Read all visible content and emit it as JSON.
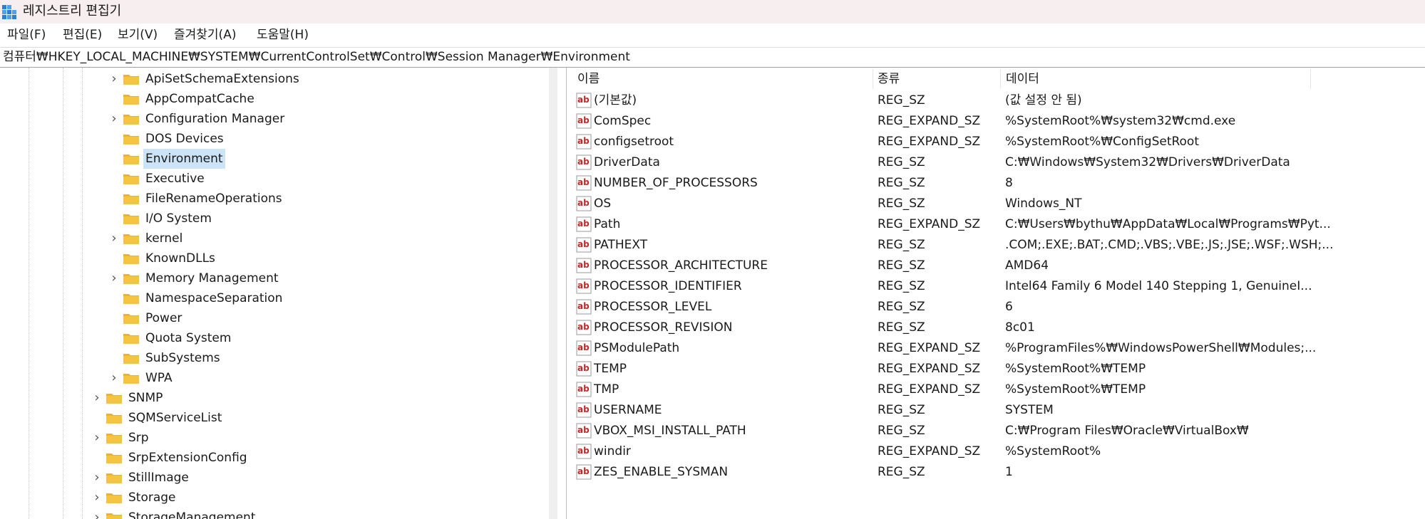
{
  "window": {
    "title": "레지스트리 편집기"
  },
  "menu": [
    "파일(F)",
    "편집(E)",
    "보기(V)",
    "즐겨찾기(A)",
    "도움말(H)"
  ],
  "address": "컴퓨터₩HKEY_LOCAL_MACHINE₩SYSTEM₩CurrentControlSet₩Control₩Session Manager₩Environment",
  "tree": {
    "nodes": [
      {
        "label": "ApiSetSchemaExtensions",
        "expandable": true
      },
      {
        "label": "AppCompatCache",
        "expandable": false
      },
      {
        "label": "Configuration Manager",
        "expandable": true
      },
      {
        "label": "DOS Devices",
        "expandable": false
      },
      {
        "label": "Environment",
        "expandable": false,
        "selected": true
      },
      {
        "label": "Executive",
        "expandable": false
      },
      {
        "label": "FileRenameOperations",
        "expandable": false
      },
      {
        "label": "I/O System",
        "expandable": false
      },
      {
        "label": "kernel",
        "expandable": true
      },
      {
        "label": "KnownDLLs",
        "expandable": false
      },
      {
        "label": "Memory Management",
        "expandable": true
      },
      {
        "label": "NamespaceSeparation",
        "expandable": false
      },
      {
        "label": "Power",
        "expandable": false
      },
      {
        "label": "Quota System",
        "expandable": false
      },
      {
        "label": "SubSystems",
        "expandable": false
      },
      {
        "label": "WPA",
        "expandable": true
      },
      {
        "label": "SNMP",
        "expandable": true
      },
      {
        "label": "SQMServiceList",
        "expandable": false
      },
      {
        "label": "Srp",
        "expandable": true
      },
      {
        "label": "SrpExtensionConfig",
        "expandable": false
      },
      {
        "label": "StillImage",
        "expandable": true
      },
      {
        "label": "Storage",
        "expandable": true
      },
      {
        "label": "StorageManagement",
        "expandable": true
      }
    ]
  },
  "list": {
    "headers": {
      "name": "이름",
      "type": "종류",
      "data": "데이터"
    },
    "rows": [
      {
        "name": "(기본값)",
        "type": "REG_SZ",
        "data": "(값 설정 안 됨)"
      },
      {
        "name": "ComSpec",
        "type": "REG_EXPAND_SZ",
        "data": "%SystemRoot%₩system32₩cmd.exe"
      },
      {
        "name": "configsetroot",
        "type": "REG_EXPAND_SZ",
        "data": "%SystemRoot%₩ConfigSetRoot"
      },
      {
        "name": "DriverData",
        "type": "REG_SZ",
        "data": "C:₩Windows₩System32₩Drivers₩DriverData"
      },
      {
        "name": "NUMBER_OF_PROCESSORS",
        "type": "REG_SZ",
        "data": "8"
      },
      {
        "name": "OS",
        "type": "REG_SZ",
        "data": "Windows_NT"
      },
      {
        "name": "Path",
        "type": "REG_EXPAND_SZ",
        "data": "C:₩Users₩bythu₩AppData₩Local₩Programs₩Pyt..."
      },
      {
        "name": "PATHEXT",
        "type": "REG_SZ",
        "data": ".COM;.EXE;.BAT;.CMD;.VBS;.VBE;.JS;.JSE;.WSF;.WSH;..."
      },
      {
        "name": "PROCESSOR_ARCHITECTURE",
        "type": "REG_SZ",
        "data": "AMD64"
      },
      {
        "name": "PROCESSOR_IDENTIFIER",
        "type": "REG_SZ",
        "data": "Intel64 Family 6 Model 140 Stepping 1, GenuineI..."
      },
      {
        "name": "PROCESSOR_LEVEL",
        "type": "REG_SZ",
        "data": "6"
      },
      {
        "name": "PROCESSOR_REVISION",
        "type": "REG_SZ",
        "data": "8c01"
      },
      {
        "name": "PSModulePath",
        "type": "REG_EXPAND_SZ",
        "data": "%ProgramFiles%₩WindowsPowerShell₩Modules;..."
      },
      {
        "name": "TEMP",
        "type": "REG_EXPAND_SZ",
        "data": "%SystemRoot%₩TEMP"
      },
      {
        "name": "TMP",
        "type": "REG_EXPAND_SZ",
        "data": "%SystemRoot%₩TEMP"
      },
      {
        "name": "USERNAME",
        "type": "REG_SZ",
        "data": "SYSTEM"
      },
      {
        "name": "VBOX_MSI_INSTALL_PATH",
        "type": "REG_SZ",
        "data": "C:₩Program Files₩Oracle₩VirtualBox₩"
      },
      {
        "name": "windir",
        "type": "REG_EXPAND_SZ",
        "data": "%SystemRoot%"
      },
      {
        "name": "ZES_ENABLE_SYSMAN",
        "type": "REG_SZ",
        "data": "1"
      }
    ]
  },
  "colors": {
    "selection": "#cce4f7",
    "titlebar": "#f7eef0",
    "folder": "#f5c542"
  },
  "icons": {
    "app": "registry-editor-icon",
    "folder": "folder-icon",
    "value": "string-value-icon",
    "expand": "chevron-right-icon"
  }
}
